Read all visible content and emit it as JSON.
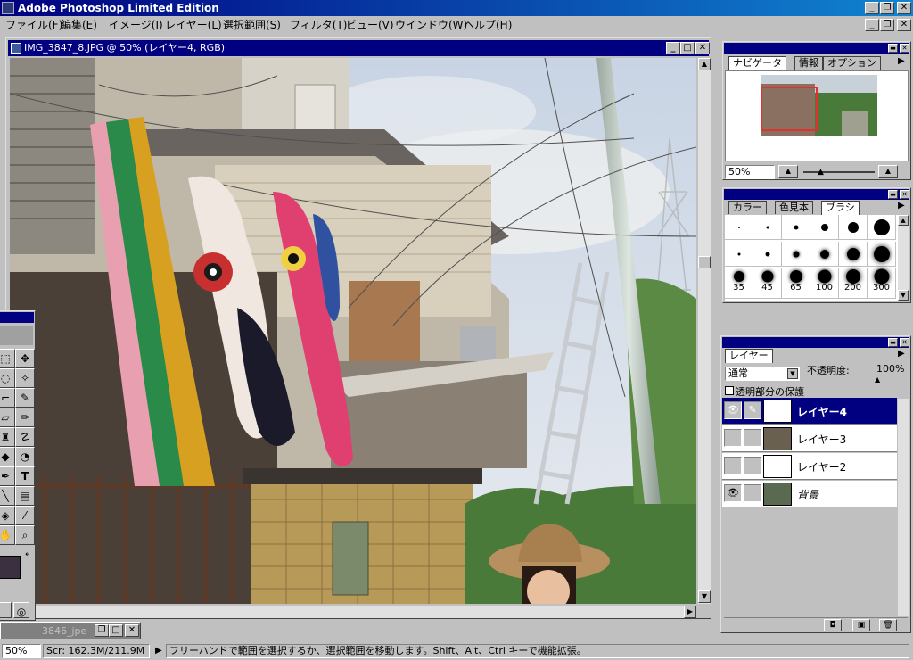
{
  "app": {
    "title": "Adobe Photoshop Limited Edition"
  },
  "menu": [
    "ファイル(F)",
    "編集(E)",
    "イメージ(I)",
    "レイヤー(L)",
    "選択範囲(S)",
    "フィルタ(T)",
    "ビュー(V)",
    "ウインドウ(W)",
    "ヘルプ(H)"
  ],
  "document": {
    "title": "IMG_3847_8.JPG @ 50% (レイヤー4, RGB)"
  },
  "minimized_doc": {
    "title": "3846_jpe"
  },
  "navigator": {
    "tabs": [
      "ナビゲータ",
      "情報",
      "オプション"
    ],
    "zoom": "50%"
  },
  "brushes": {
    "tabs": [
      "カラー",
      "色見本",
      "ブラシ"
    ],
    "size_labels": [
      "35",
      "45",
      "65",
      "100",
      "200",
      "300"
    ]
  },
  "layers": {
    "tab": "レイヤー",
    "blend_mode": "通常",
    "opacity_label": "不透明度:",
    "opacity_value": "100%",
    "preserve_label": "透明部分の保護",
    "items": [
      {
        "name": "レイヤー4",
        "visible": true,
        "selected": true
      },
      {
        "name": "レイヤー3",
        "visible": false,
        "selected": false
      },
      {
        "name": "レイヤー2",
        "visible": false,
        "selected": false
      },
      {
        "name": "背景",
        "visible": true,
        "selected": false
      }
    ]
  },
  "status": {
    "zoom": "50%",
    "scratch": "Scr: 162.3M/211.9M",
    "hint": "フリーハンドで範囲を選択するか、選択範囲を移動します。Shift、Alt、Ctrl キーで機能拡張。"
  },
  "icons": {
    "eye": "eye-icon",
    "brush": "paintbrush-icon",
    "new_layer": "new-layer-icon",
    "trash": "trash-icon",
    "mask": "layer-mask-icon"
  }
}
